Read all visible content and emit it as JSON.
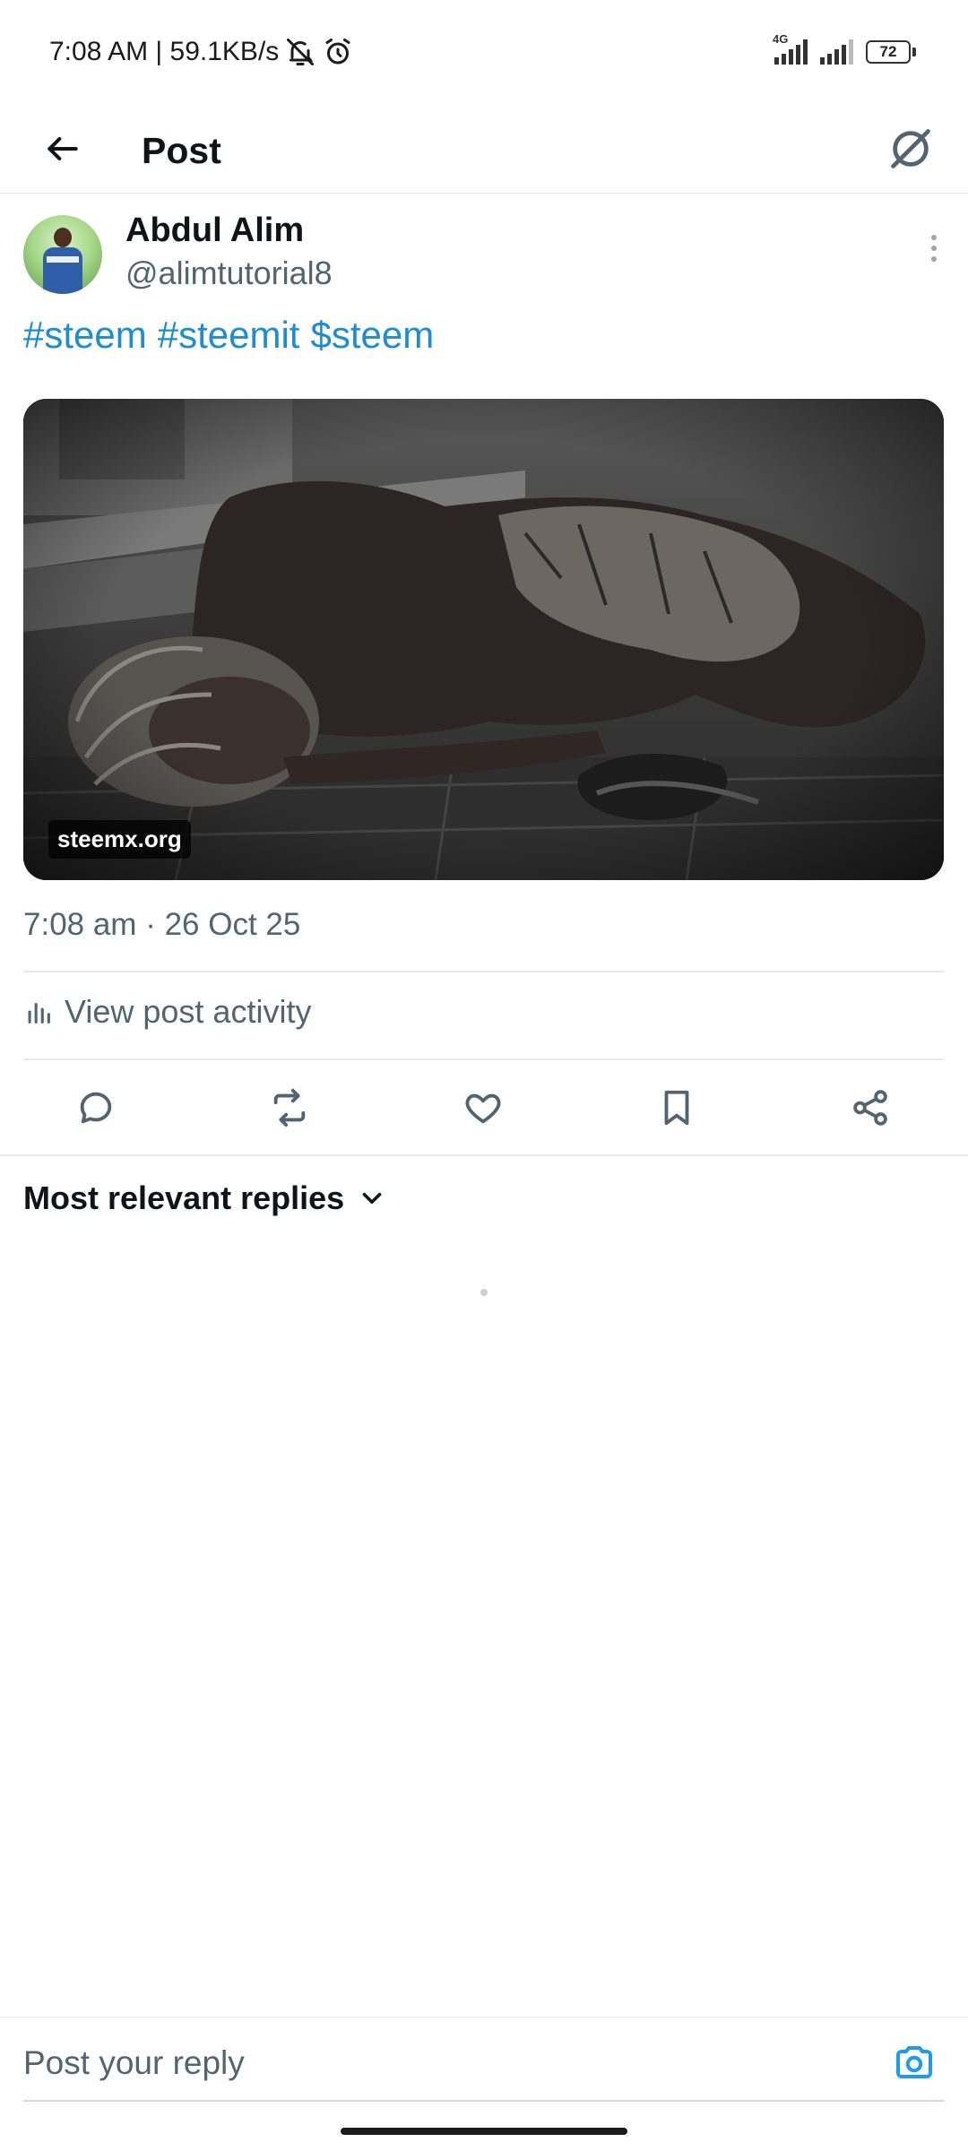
{
  "status_bar": {
    "time_speed": "7:08 AM | 59.1KB/s",
    "network_type": "4G",
    "battery_level": "72"
  },
  "header": {
    "title": "Post"
  },
  "post": {
    "author_name": "Abdul Alim",
    "author_handle": "@alimtutorial8",
    "tags": [
      "#steem",
      "#steemit",
      "$steem"
    ],
    "media_watermark": "steemx.org",
    "timestamp": "7:08 am · 26 Oct 25",
    "activity_label": "View post activity"
  },
  "actions": {
    "icons": [
      "reply-icon",
      "repost-icon",
      "like-icon",
      "bookmark-icon",
      "share-icon"
    ]
  },
  "replies": {
    "sort_label": "Most relevant replies"
  },
  "reply_bar": {
    "placeholder": "Post your reply"
  },
  "colors": {
    "accent": "#1d9bf0",
    "text_primary": "#0f1419",
    "text_secondary": "#536471",
    "divider": "#e6e9ec"
  }
}
